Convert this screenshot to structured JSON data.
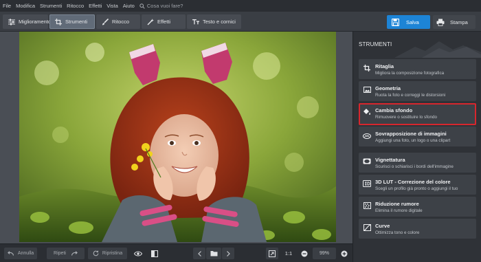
{
  "menu": {
    "items": [
      "File",
      "Modifica",
      "Strumenti",
      "Ritocco",
      "Effetti",
      "Vista",
      "Aiuto"
    ],
    "search_placeholder": "Cosa vuoi fare?"
  },
  "toolbar": {
    "tabs": [
      {
        "label": "Miglioramento",
        "icon": "sliders-icon",
        "active": false
      },
      {
        "label": "Strumenti",
        "icon": "crop-icon",
        "active": true
      },
      {
        "label": "Ritocco",
        "icon": "brush-icon",
        "active": false
      },
      {
        "label": "Effetti",
        "icon": "magic-wand-icon",
        "active": false
      },
      {
        "label": "Testo e cornici",
        "icon": "text-icon",
        "active": false
      }
    ],
    "save_label": "Salva",
    "print_label": "Stampa",
    "accent": "#1d84d6"
  },
  "bottom": {
    "undo": "Annulla",
    "redo": "Ripeti",
    "restore": "Ripristina",
    "ratio": "1:1",
    "zoom": "99%"
  },
  "panel": {
    "title": "STRUMENTI",
    "tools": [
      {
        "title": "Ritaglia",
        "desc": "Migliora la composizione fotografica",
        "icon": "crop-icon",
        "highlighted": false
      },
      {
        "title": "Geometria",
        "desc": "Ruota la foto e correggi le distorsioni",
        "icon": "image-icon",
        "highlighted": false
      },
      {
        "title": "Cambia sfondo",
        "desc": "Rimuovere o sostituire lo sfondo",
        "icon": "paint-bucket-icon",
        "highlighted": true
      },
      {
        "title": "Sovrapposizione di immagini",
        "desc": "Aggiungi una foto, un logo o una clipart",
        "icon": "layers-icon",
        "highlighted": false
      },
      {
        "title": "Vignettatura",
        "desc": "Scurisci o schiarisci i bordi dell'immagine",
        "icon": "vignette-icon",
        "highlighted": false
      },
      {
        "title": "3D LUT - Correzione del colore",
        "desc": "Scegli un profilo già pronto o aggiungi il tuo",
        "icon": "lut-icon",
        "highlighted": false
      },
      {
        "title": "Riduzione rumore",
        "desc": "Elimina il rumore digitale",
        "icon": "noise-icon",
        "highlighted": false
      },
      {
        "title": "Curve",
        "desc": "Ottimizza tono e colore",
        "icon": "curve-icon",
        "highlighted": false
      }
    ],
    "highlight_color": "#d8262d"
  }
}
